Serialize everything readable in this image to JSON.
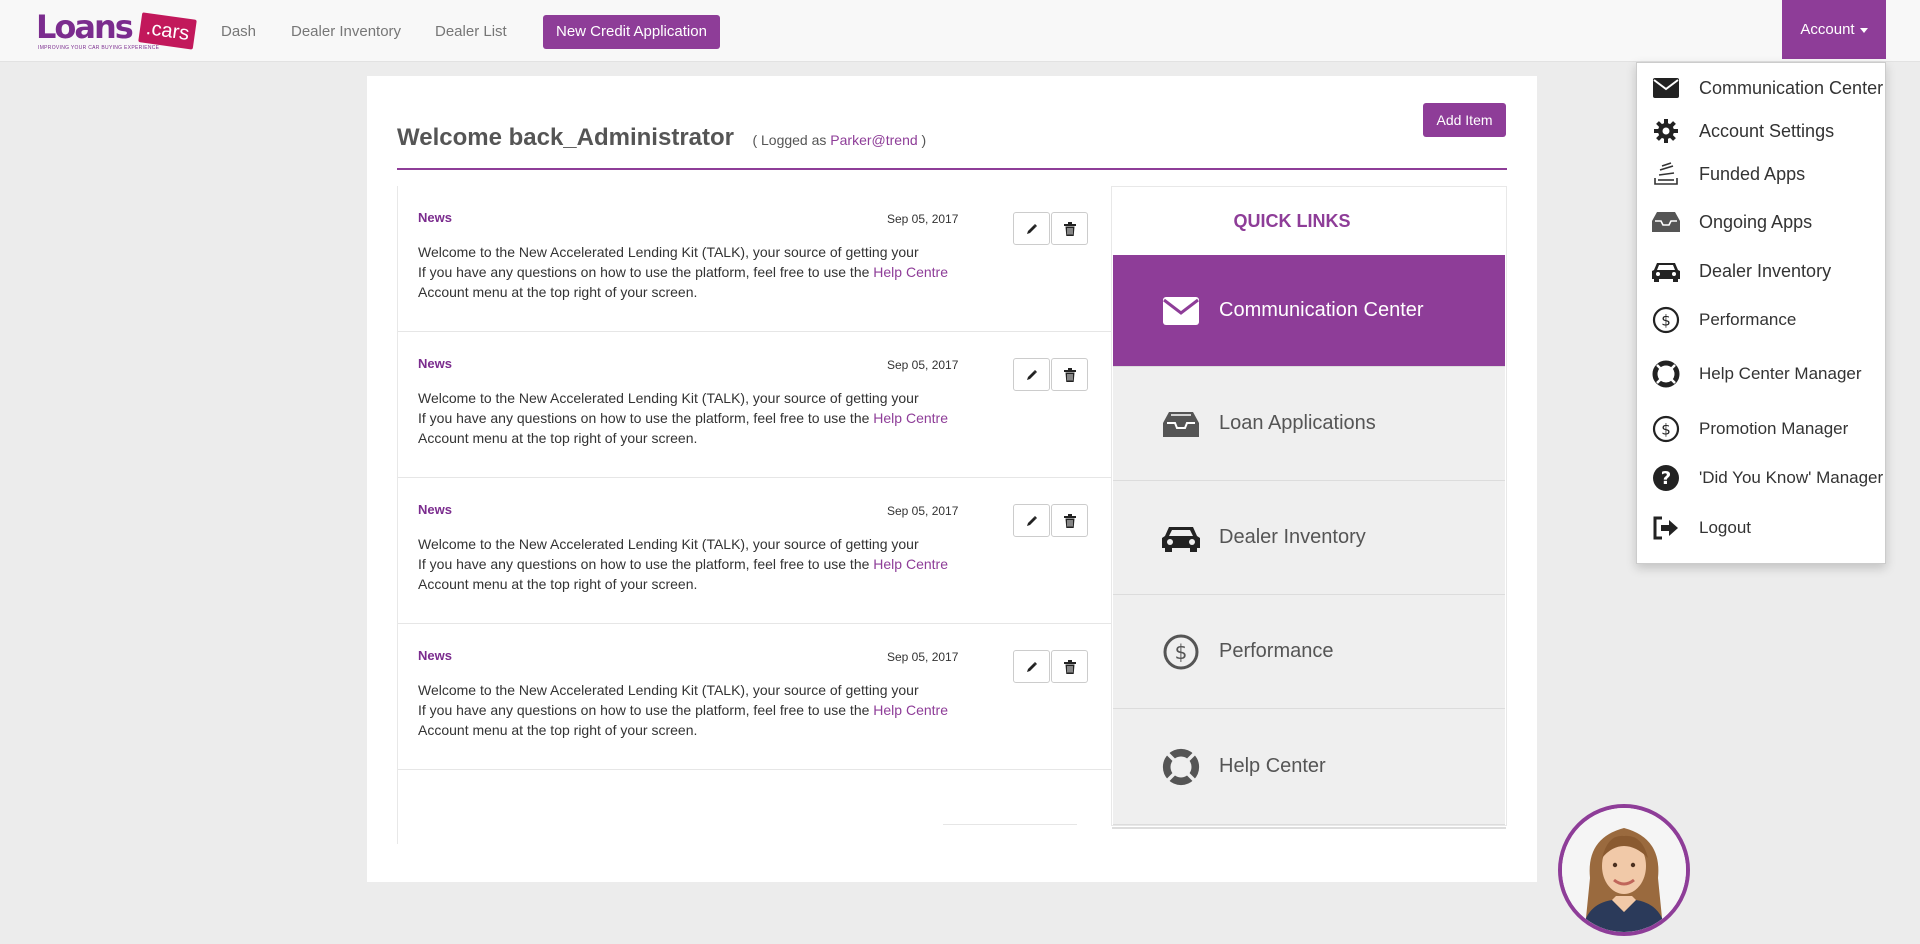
{
  "brand": {
    "logo_main": "Loans",
    "logo_accent": ".cars",
    "tagline": "IMPROVING YOUR CAR BUYING EXPERIENCE",
    "accent_color": "#8e3d98"
  },
  "nav": {
    "links": [
      "Dash",
      "Dealer Inventory",
      "Dealer List"
    ],
    "cta_label": "New Credit Application",
    "account_label": "Account"
  },
  "account_menu": {
    "items": [
      {
        "label": "Communication Center",
        "icon": "envelope-icon"
      },
      {
        "label": "Account Settings",
        "icon": "gear-icon"
      },
      {
        "label": "Funded Apps",
        "icon": "stack-icon"
      },
      {
        "label": "Ongoing Apps",
        "icon": "inbox-icon"
      },
      {
        "label": "Dealer Inventory",
        "icon": "car-icon"
      },
      {
        "label": "Performance",
        "icon": "dollar-circle-icon"
      },
      {
        "label": "Help Center Manager",
        "icon": "lifebuoy-icon"
      },
      {
        "label": "Promotion Manager",
        "icon": "dollar-circle-icon"
      },
      {
        "label": "'Did You Know' Manager",
        "icon": "question-circle-icon"
      },
      {
        "label": "Logout",
        "icon": "sign-out-icon"
      }
    ]
  },
  "welcome": {
    "title": "Welcome back_Administrator",
    "logged_prefix": "( Logged as ",
    "username": "Parker@trend",
    "logged_suffix": " )"
  },
  "add_item_label": "Add Item",
  "news": [
    {
      "tag": "News",
      "date": "Sep 05, 2017",
      "line1": "Welcome to the New  Accelerated Lending Kit (TALK), your source of getting your",
      "line2": "If you have any questions on how to use the platform, feel free to use the ",
      "link": "Help Centre",
      "line3": "Account menu at the top right of your screen."
    },
    {
      "tag": "News",
      "date": "Sep 05, 2017",
      "line1": "Welcome to the New  Accelerated Lending Kit (TALK), your source of getting your",
      "line2": "If you have any questions on how to use the platform, feel free to use the ",
      "link": "Help Centre",
      "line3": "Account menu at the top right of your screen."
    },
    {
      "tag": "News",
      "date": "Sep 05, 2017",
      "line1": "Welcome to the New  Accelerated Lending Kit (TALK), your source of getting your",
      "line2": "If you have any questions on how to use the platform, feel free to use the ",
      "link": "Help Centre",
      "line3": "Account menu at the top right of your screen."
    },
    {
      "tag": "News",
      "date": "Sep 05, 2017",
      "line1": "Welcome to the New  Accelerated Lending Kit (TALK), your source of getting your",
      "line2": "If you have any questions on how to use the platform, feel free to use the ",
      "link": "Help Centre",
      "line3": "Account menu at the top right of your screen."
    }
  ],
  "quick_links": {
    "title": "QUICK LINKS",
    "items": [
      {
        "label": "Communication Center",
        "icon": "envelope-icon",
        "active": true
      },
      {
        "label": "Loan Applications",
        "icon": "inbox-icon",
        "active": false
      },
      {
        "label": "Dealer Inventory",
        "icon": "car-icon",
        "active": false
      },
      {
        "label": "Performance",
        "icon": "dollar-circle-icon",
        "active": false
      },
      {
        "label": "Help Center",
        "icon": "lifebuoy-icon",
        "active": false
      }
    ]
  }
}
